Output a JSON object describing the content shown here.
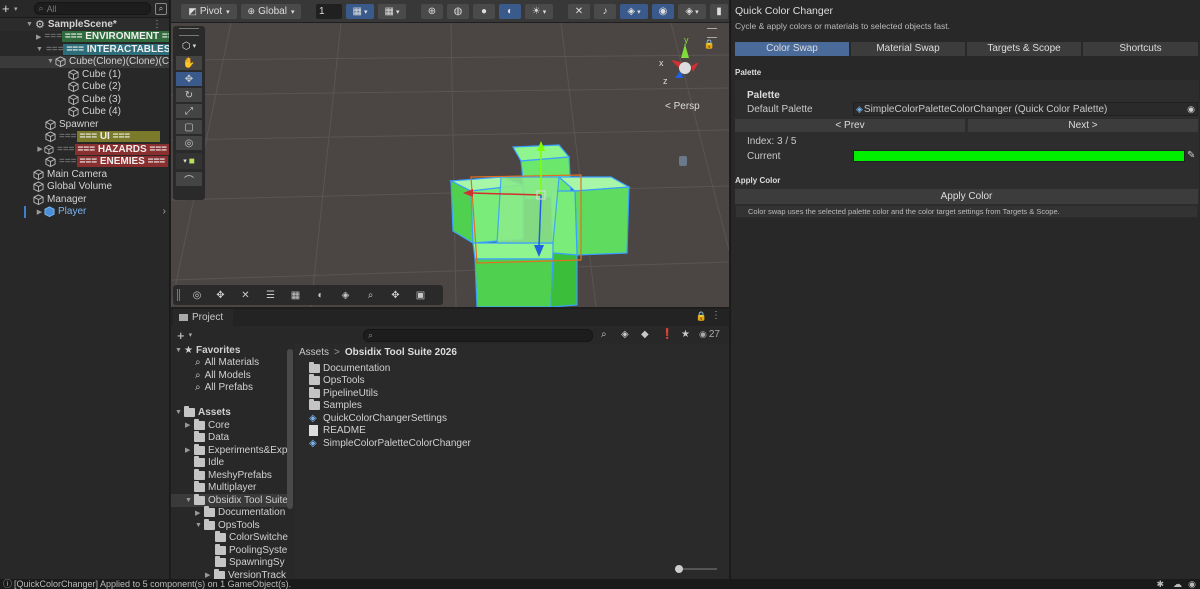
{
  "hierarchy": {
    "search_placeholder": "All",
    "scene_name": "SampleScene*",
    "items": [
      {
        "label": "=== ENVIRONMENT ==="
      },
      {
        "label": "=== INTERACTABLES ==="
      },
      {
        "label": "Cube(Clone)(Clone)(C"
      },
      {
        "label": "Cube (1)"
      },
      {
        "label": "Cube (2)"
      },
      {
        "label": "Cube (3)"
      },
      {
        "label": "Cube (4)"
      },
      {
        "label": "Spawner"
      },
      {
        "label": "=== UI ==="
      },
      {
        "label": "=== HAZARDS ==="
      },
      {
        "label": "=== ENEMIES ==="
      },
      {
        "label": "Main Camera"
      },
      {
        "label": "Global Volume"
      },
      {
        "label": "Manager"
      },
      {
        "label": "Player"
      }
    ],
    "tag_colors": {
      "environment": "#2f6b3c",
      "interactables": "#2e6d7a",
      "ui": "#7a7a2a",
      "hazards": "#8a2f2f",
      "enemies": "#8a2f2f"
    }
  },
  "scene_toolbar": {
    "pivot": "Pivot",
    "global": "Global",
    "grid_value": "1"
  },
  "scene_view": {
    "persp_label": "< Persp",
    "gizmo_axes": {
      "x": "x",
      "y": "y",
      "z": "z"
    }
  },
  "project": {
    "tab_label": "Project",
    "hidden_count": "27",
    "favorites_label": "Favorites",
    "favorites": [
      "All Materials",
      "All Models",
      "All Prefabs"
    ],
    "assets_label": "Assets",
    "tree": [
      "Core",
      "Data",
      "Experiments&Exp",
      "Idle",
      "MeshyPrefabs",
      "Multiplayer",
      "Obsidix Tool Suite",
      "Documentation",
      "OpsTools",
      "ColorSwitche",
      "PoolingSyste",
      "SpawningSy",
      "VersionTrack"
    ],
    "breadcrumb_root": "Assets",
    "breadcrumb_sep": ">",
    "breadcrumb_current": "Obsidix Tool Suite 2026",
    "contents": [
      "Documentation",
      "OpsTools",
      "PipelineUtils",
      "Samples",
      "QuickColorChangerSettings",
      "README",
      "SimpleColorPaletteColorChanger"
    ]
  },
  "inspector": {
    "title": "Quick Color Changer",
    "subtitle": "Cycle & apply colors or materials to selected objects fast.",
    "tabs": [
      "Color Swap",
      "Material Swap",
      "Targets & Scope",
      "Shortcuts"
    ],
    "palette_section": "Palette",
    "palette_header": "Palette",
    "default_palette_label": "Default Palette",
    "default_palette_value": "SimpleColorPaletteColorChanger (Quick Color Palette)",
    "prev_label": "< Prev",
    "next_label": "Next >",
    "index_label": "Index: 3 / 5",
    "current_label": "Current",
    "current_color": "#00ee00",
    "apply_section": "Apply Color",
    "apply_button": "Apply Color",
    "help_text": "Color swap uses the selected palette color and the color target settings from Targets & Scope."
  },
  "status_bar": {
    "message": "[QuickColorChanger] Applied to 5 component(s) on 1 GameObject(s)."
  },
  "colors": {
    "accent": "#3a5a8c",
    "selected_tab": "#4a6a9a",
    "cube_green": "#55e055"
  }
}
